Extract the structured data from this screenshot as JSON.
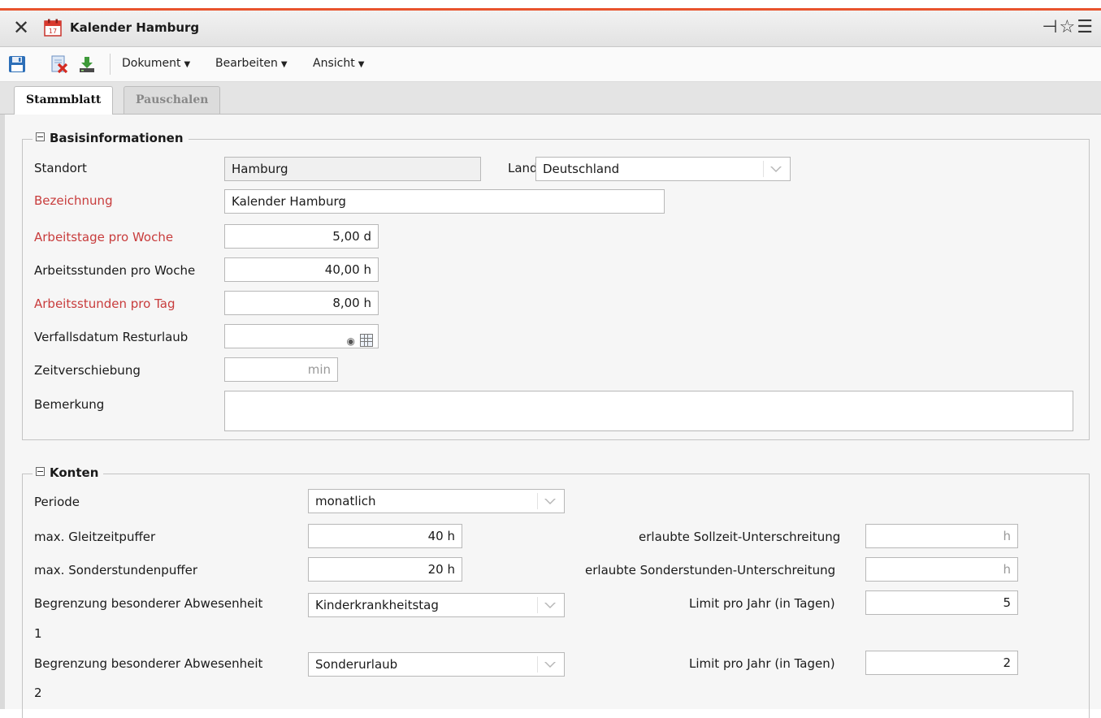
{
  "window": {
    "title": "Kalender Hamburg",
    "close_icon": "close-icon",
    "calendar_icon": "calendar-icon",
    "right_icons": [
      "pin-icon",
      "star-icon",
      "menu-icon"
    ]
  },
  "toolbar": {
    "icons": [
      "save-icon",
      "delete-document-icon",
      "download-icon"
    ],
    "menus": [
      {
        "label": "Dokument"
      },
      {
        "label": "Bearbeiten"
      },
      {
        "label": "Ansicht"
      }
    ]
  },
  "tabs": [
    {
      "label": "Stammblatt",
      "active": true
    },
    {
      "label": "Pauschalen",
      "active": false
    }
  ],
  "basis": {
    "legend": "Basisinformationen",
    "standort_label": "Standort",
    "standort_value": "Hamburg",
    "land_label": "Land",
    "land_value": "Deutschland",
    "bezeichnung_label": "Bezeichnung",
    "bezeichnung_value": "Kalender Hamburg",
    "arbeitstage_label": "Arbeitstage pro Woche",
    "arbeitstage_value": "5,00 d",
    "stunden_woche_label": "Arbeitsstunden pro Woche",
    "stunden_woche_value": "40,00 h",
    "stunden_tag_label": "Arbeitsstunden pro Tag",
    "stunden_tag_value": "8,00 h",
    "verfall_label": "Verfallsdatum Resturlaub",
    "verfall_value": "",
    "zeitverschiebung_label": "Zeitverschiebung",
    "zeitverschiebung_unit": "min",
    "bemerkung_label": "Bemerkung",
    "bemerkung_value": ""
  },
  "konten": {
    "legend": "Konten",
    "periode_label": "Periode",
    "periode_value": "monatlich",
    "gleitzeit_label": "max. Gleitzeitpuffer",
    "gleitzeit_value": "40 h",
    "sollzeit_label": "erlaubte Sollzeit-Unterschreitung",
    "sollzeit_unit": "h",
    "sonderstunden_label": "max. Sonderstundenpuffer",
    "sonderstunden_value": "20 h",
    "sonder_unter_label": "erlaubte Sonderstunden-Unterschreitung",
    "sonder_unter_unit": "h",
    "begrenzung1_label_line1": "Begrenzung besonderer Abwesenheit",
    "begrenzung1_label_line2": "1",
    "begrenzung1_value": "Kinderkrankheitstag",
    "limit1_label": "Limit pro Jahr (in Tagen)",
    "limit1_value": "5",
    "begrenzung2_label_line1": "Begrenzung besonderer Abwesenheit",
    "begrenzung2_label_line2": "2",
    "begrenzung2_value": "Sonderurlaub",
    "limit2_label": "Limit pro Jahr (in Tagen)",
    "limit2_value": "2"
  },
  "colors": {
    "accent_line": "#e8532d",
    "required_label": "#c83c3c"
  }
}
